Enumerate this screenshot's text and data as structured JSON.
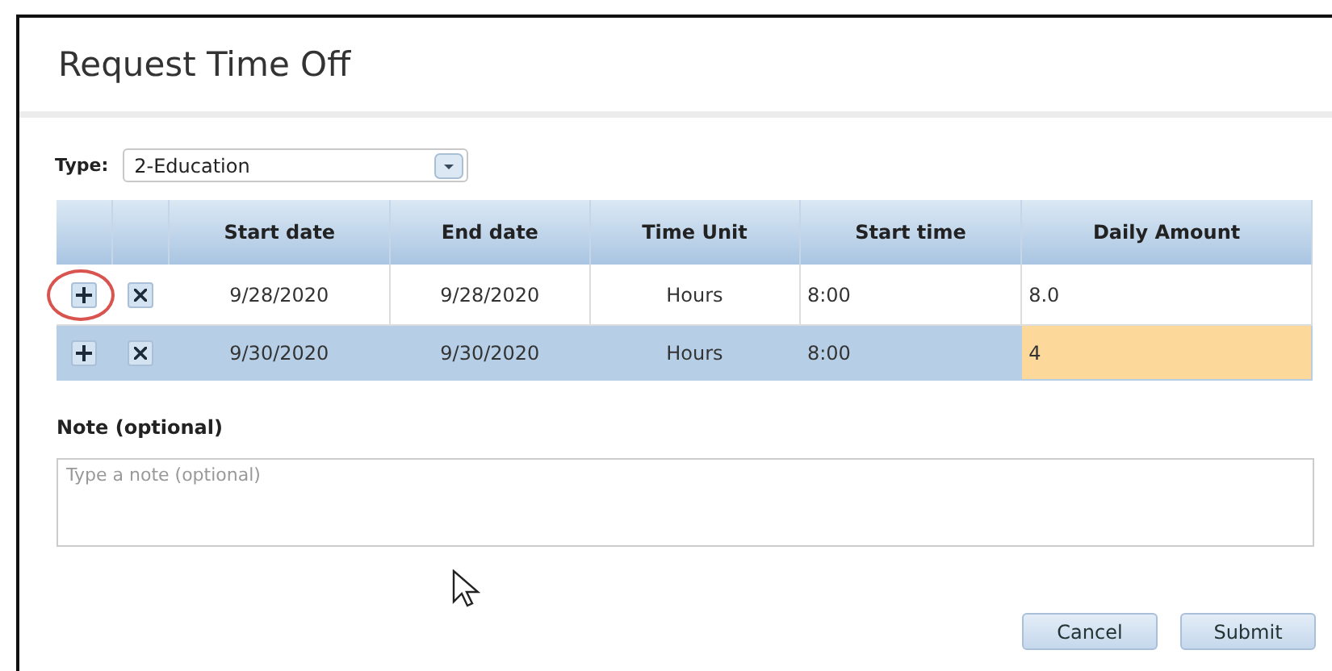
{
  "dialog": {
    "title": "Request Time Off"
  },
  "type_field": {
    "label": "Type:",
    "value": "2-Education"
  },
  "table": {
    "columns": [
      "Start date",
      "End date",
      "Time Unit",
      "Start time",
      "Daily Amount"
    ],
    "rows": [
      {
        "selected": false,
        "circled": true,
        "cells": [
          {
            "text": "9/28/2020",
            "edited": false
          },
          {
            "text": "9/28/2020",
            "edited": false
          },
          {
            "text": "Hours",
            "edited": false
          },
          {
            "text": "8:00",
            "edited": false
          },
          {
            "text": "8.0",
            "edited": false
          }
        ]
      },
      {
        "selected": true,
        "circled": false,
        "cells": [
          {
            "text": "9/30/2020",
            "edited": false
          },
          {
            "text": "9/30/2020",
            "edited": false
          },
          {
            "text": "Hours",
            "edited": false
          },
          {
            "text": "8:00",
            "edited": false
          },
          {
            "text": "4",
            "edited": true
          }
        ]
      }
    ]
  },
  "note": {
    "label": "Note (optional)",
    "placeholder": "Type a note (optional)"
  },
  "buttons": [
    "Cancel",
    "Submit"
  ]
}
